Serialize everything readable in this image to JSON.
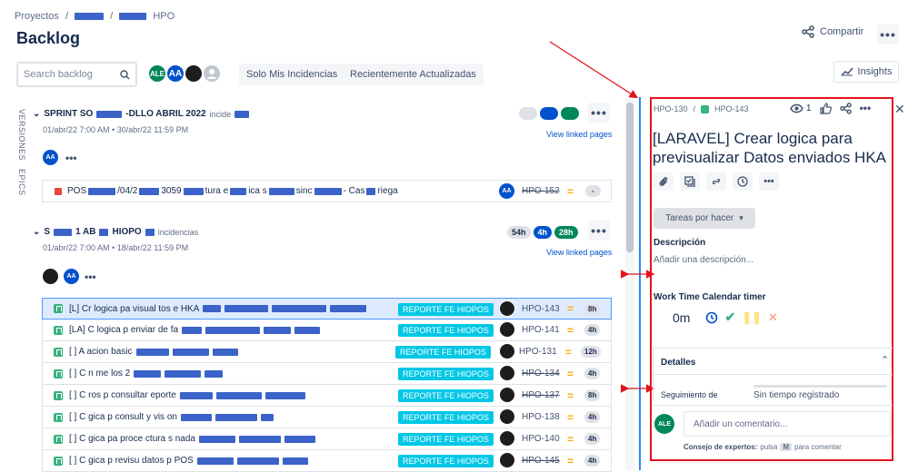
{
  "breadcrumbs": {
    "root": "Proyectos",
    "sep": "/",
    "project": "HPO"
  },
  "page_title": "Backlog",
  "header": {
    "share_label": "Compartir",
    "more": "•••"
  },
  "toolbar": {
    "search_placeholder": "Search backlog",
    "avatars": [
      {
        "initials": "ALE",
        "color": "#00875a"
      },
      {
        "initials": "AA",
        "color": "#0052cc"
      }
    ],
    "filters": [
      "Solo Mis Incidencias",
      "Recientemente Actualizadas"
    ],
    "insights_label": "Insights"
  },
  "side_tabs": {
    "versions": "VERSIONES",
    "epics": "EPICS"
  },
  "sprint1": {
    "name_prefix": "SPRINT SO",
    "name_mid": "-DLLO ABRIL 2022",
    "count_suffix": "incide",
    "dates": "01/abr/22 7:00 AM • 30/abr/22 11:59 PM",
    "view_linked": "View linked pages",
    "assignee": "AA",
    "issue": {
      "prefix": "POS",
      "mid": "/04/2",
      "mid2": "3059",
      "text1": "tura e",
      "text2": "ica s",
      "text3": "sinc",
      "text4": "- Cas",
      "text5": "riega",
      "assignee": "AA",
      "key": "HPO-152",
      "est": "-"
    }
  },
  "sprint2": {
    "name_prefix": "S",
    "name_mid": "1 AB",
    "name_suffix": "HIOPO",
    "count_suffix": "incidencias",
    "dates": "01/abr/22 7:00 AM • 18/abr/22 11:59 PM",
    "view_linked": "View linked pages",
    "stats": {
      "todo": "54h",
      "inprogress": "4h",
      "done": "28h"
    },
    "assignee": "AA",
    "issues": [
      {
        "summary": "[L] Cr logica pa visual tos e HKA",
        "epic": "REPORTE FE HIOPOS",
        "key": "HPO-143",
        "done": false,
        "est": "8h"
      },
      {
        "summary": "[LA] C logica p enviar de fa",
        "epic": "REPORTE FE HIOPOS",
        "key": "HPO-141",
        "done": false,
        "est": "4h"
      },
      {
        "summary": "[ ] A acion basic",
        "epic": "REPORTE FE HIOPOS",
        "key": "HPO-131",
        "done": false,
        "est": "12h"
      },
      {
        "summary": "[ ] C n me los 2",
        "epic": "REPORTE FE HIOPOS",
        "key": "HPO-134",
        "done": true,
        "est": "4h"
      },
      {
        "summary": "[ ] C ros p consultar eporte",
        "epic": "REPORTE FE HIOPOS",
        "key": "HPO-137",
        "done": true,
        "est": "8h"
      },
      {
        "summary": "[ ] C gica p consult y vis on",
        "epic": "REPORTE FE HIOPOS",
        "key": "HPO-138",
        "done": false,
        "est": "4h"
      },
      {
        "summary": "[ ] C gica pa proce ctura s nada",
        "epic": "REPORTE FE HIOPOS",
        "key": "HPO-140",
        "done": false,
        "est": "4h"
      },
      {
        "summary": "[ ] C gica p revisu datos p POS",
        "epic": "REPORTE FE HIOPOS",
        "key": "HPO-145",
        "done": true,
        "est": "4h"
      }
    ]
  },
  "detail": {
    "parent_key": "HPO-130",
    "key": "HPO-143",
    "watchers": "1",
    "title": "[LARAVEL] Crear logica para previsualizar Datos enviados HKA",
    "status": "Tareas por hacer",
    "description_label": "Descripción",
    "description_placeholder": "Añadir una descripción...",
    "timer_label": "Work Time Calendar timer",
    "timer_value": "0m",
    "details_label": "Detalles",
    "tracking_label": "Seguimiento de",
    "tracking_value": "Sin tiempo registrado",
    "comment_avatar": "ALE",
    "comment_placeholder": "Añadir un comentario...",
    "tip_bold": "Consejo de expertos:",
    "tip_press": "pulsa",
    "tip_key": "M",
    "tip_rest": "para comentar"
  },
  "colors": {
    "accent": "#0052cc",
    "epic": "#00c7e6",
    "highlight_border": "#e3131c",
    "annotation_arrow": "#e3131c"
  }
}
